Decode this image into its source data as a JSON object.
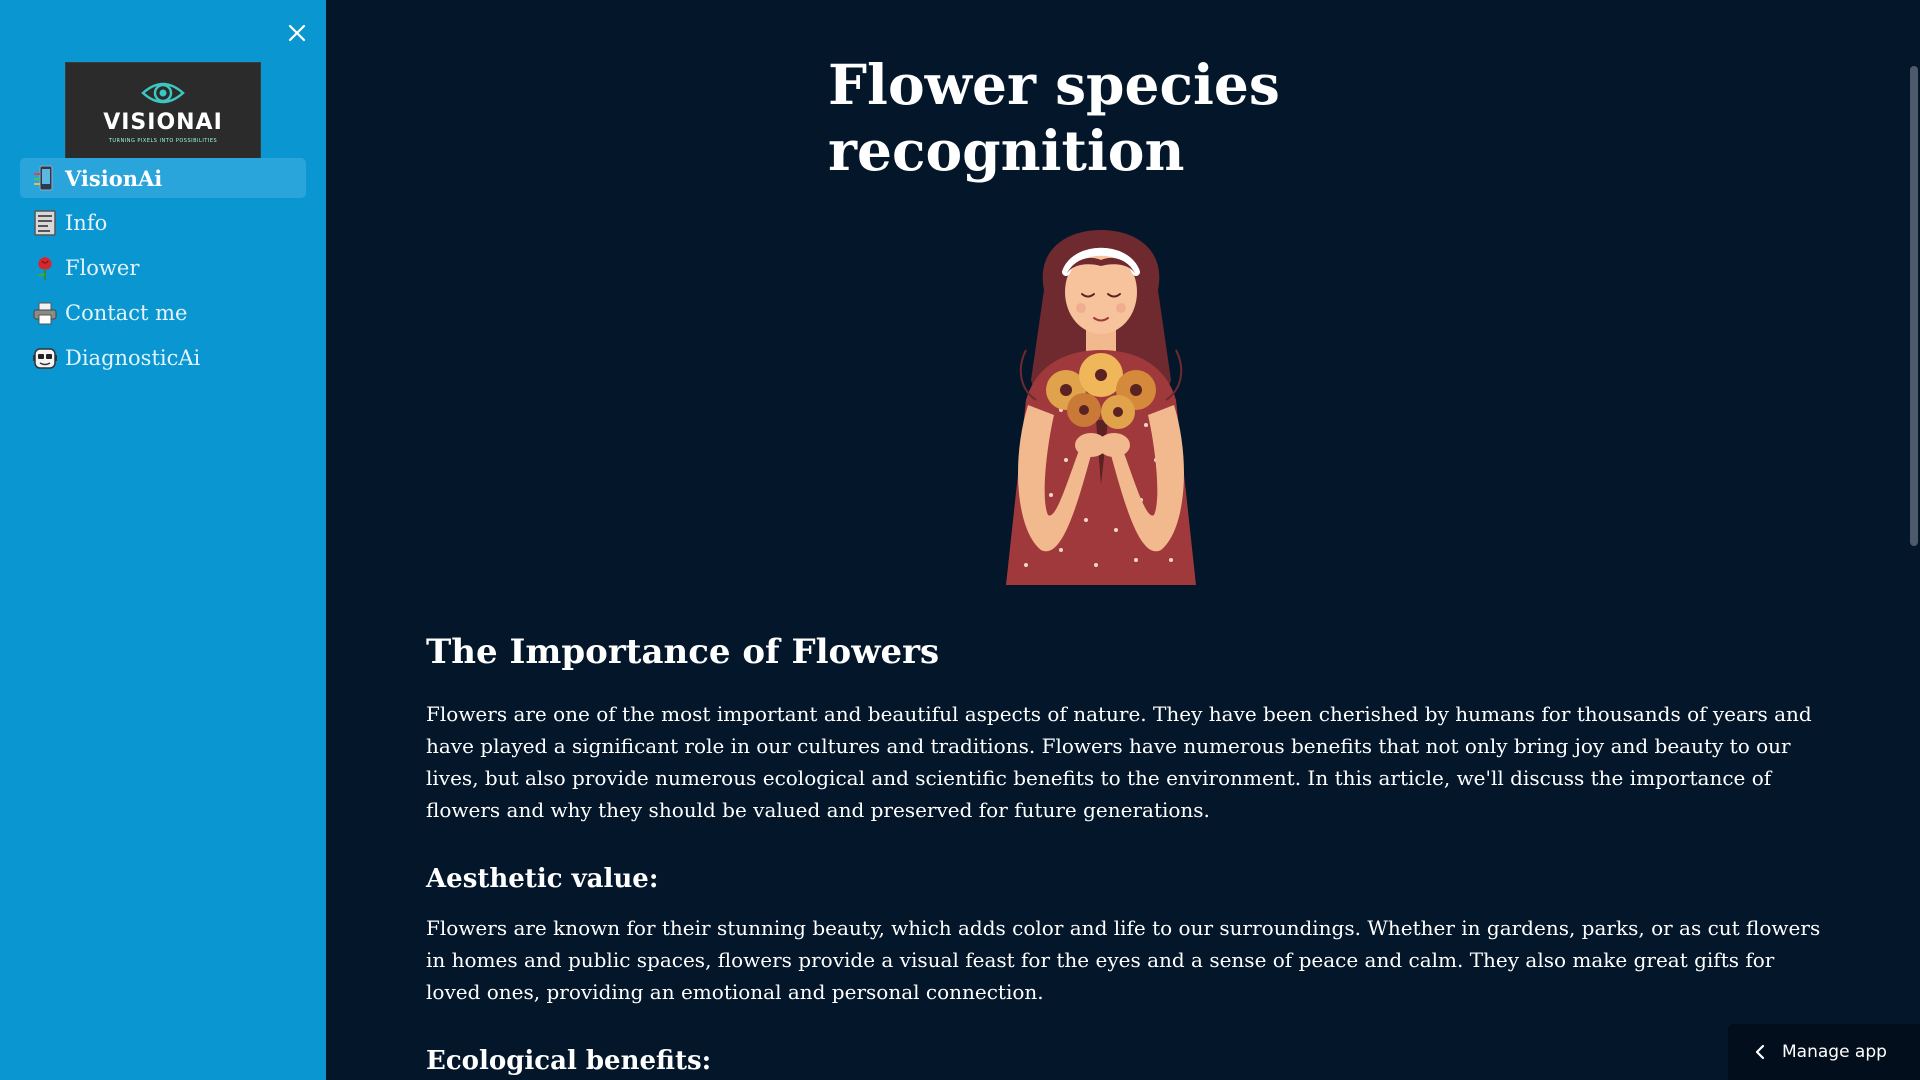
{
  "sidebar": {
    "logo": {
      "text": "VISIONAI",
      "tagline": "TURNING PIXELS INTO POSSIBILITIES"
    },
    "items": [
      {
        "label": "VisionAi",
        "icon": "phone-grid-icon",
        "active": true
      },
      {
        "label": "Info",
        "icon": "document-icon",
        "active": false
      },
      {
        "label": "Flower",
        "icon": "rose-icon",
        "active": false
      },
      {
        "label": "Contact me",
        "icon": "printer-icon",
        "active": false
      },
      {
        "label": "DiagnosticAi",
        "icon": "robot-face-icon",
        "active": false
      }
    ]
  },
  "main": {
    "title": "Flower species recognition",
    "sections": [
      {
        "heading": "The Importance of Flowers",
        "text": "Flowers are one of the most important and beautiful aspects of nature. They have been cherished by humans for thousands of years and have played a significant role in our cultures and traditions. Flowers have numerous benefits that not only bring joy and beauty to our lives, but also provide numerous ecological and scientific benefits to the environment. In this article, we'll discuss the importance of flowers and why they should be valued and preserved for future generations."
      },
      {
        "heading": "Aesthetic value:",
        "text": "Flowers are known for their stunning beauty, which adds color and life to our surroundings. Whether in gardens, parks, or as cut flowers in homes and public spaces, flowers provide a visual feast for the eyes and a sense of peace and calm. They also make great gifts for loved ones, providing an emotional and personal connection."
      },
      {
        "heading": "Ecological benefits:"
      }
    ]
  },
  "manage_app": {
    "label": "Manage app"
  },
  "colors": {
    "sidebar_bg": "#0a97d1",
    "sidebar_active": "#2aa5dc",
    "main_bg": "#03162a",
    "dress": "#a0393b",
    "hair": "#6e2a2e",
    "flowers": "#e0a24a"
  }
}
